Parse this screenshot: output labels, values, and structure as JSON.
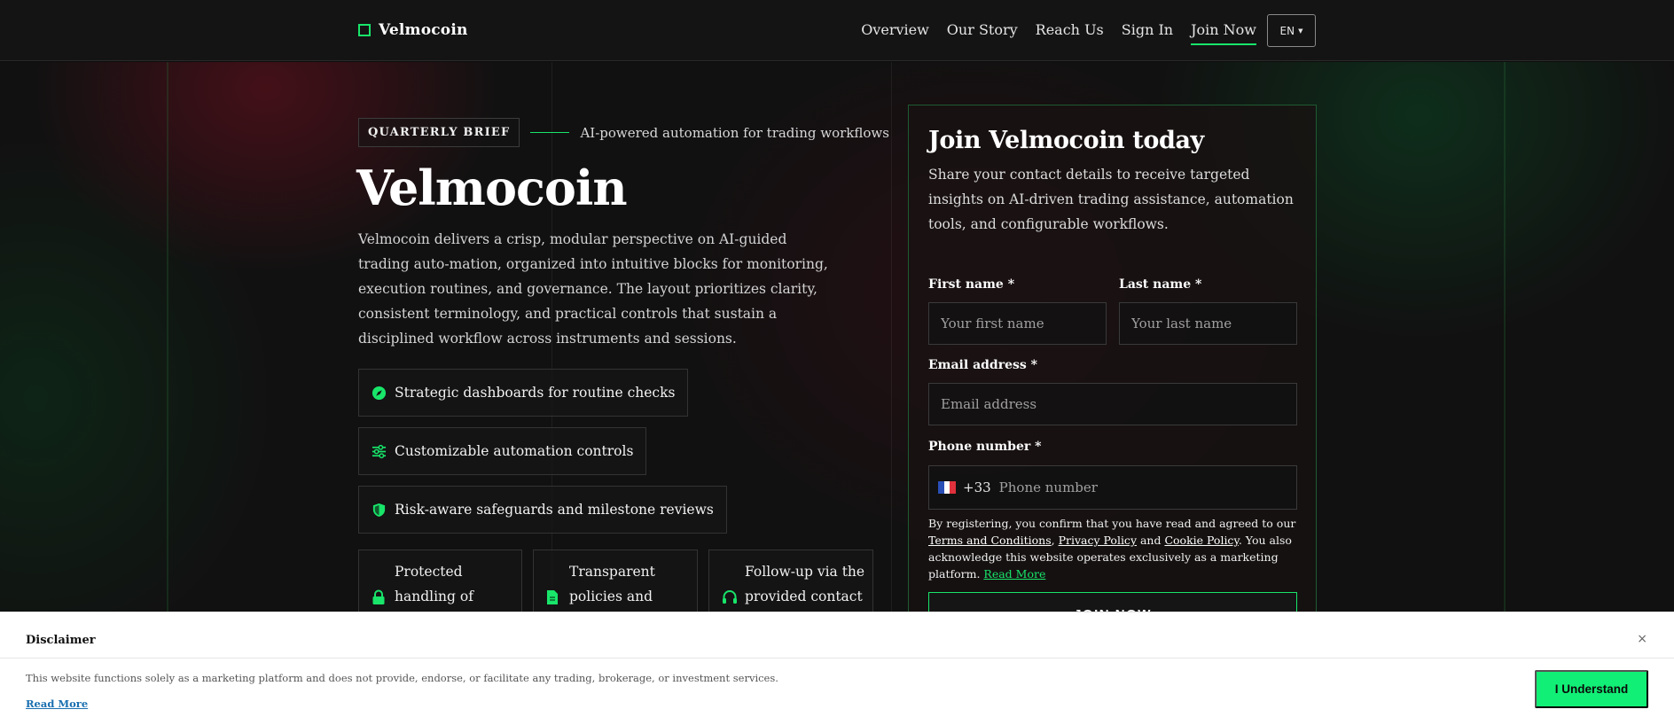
{
  "header": {
    "brand": "Velmocoin",
    "nav": [
      "Overview",
      "Our Story",
      "Reach Us",
      "Sign In",
      "Join Now"
    ],
    "active_nav": "Join Now",
    "language": "EN"
  },
  "hero": {
    "kicker_badge": "QUARTERLY BRIEF",
    "kicker_text": "AI-powered automation for trading workflows",
    "title": "Velmocoin",
    "description": "Velmocoin delivers a crisp, modular perspective on AI-guided trading auto-mation, organized into intuitive blocks for monitoring, execution routines, and governance. The layout prioritizes clarity, consistent terminology, and practical controls that sustain a disciplined workflow across instruments and sessions.",
    "features": [
      {
        "label": "Strategic dashboards for routine checks",
        "icon": "compass-icon"
      },
      {
        "label": "Customizable automation controls",
        "icon": "sliders-icon"
      },
      {
        "label": "Risk-aware safeguards and milestone reviews",
        "icon": "shield-icon"
      }
    ],
    "cards": [
      {
        "label": "Protected handling of",
        "icon": "lock-icon"
      },
      {
        "label": "Transparent policies and",
        "icon": "document-icon"
      },
      {
        "label": "Follow-up via the provided contact",
        "icon": "headset-icon"
      }
    ]
  },
  "form": {
    "title": "Join Velmocoin today",
    "subtitle": "Share your contact details to receive targeted insights on AI-driven trading assistance, automation tools, and configurable workflows.",
    "first_name_label": "First name *",
    "first_name_placeholder": "Your first name",
    "last_name_label": "Last name *",
    "last_name_placeholder": "Your last name",
    "email_label": "Email address *",
    "email_placeholder": "Email address",
    "phone_label": "Phone number *",
    "phone_dial_code": "+33",
    "phone_placeholder": "Phone number",
    "consent": {
      "prefix": "By registering, you confirm that you have read and agreed to our ",
      "terms": "Terms and Conditions",
      "comma": ", ",
      "privacy": "Privacy Policy",
      "and": " and ",
      "cookie": "Cookie Policy",
      "suffix": ". You also acknowledge this website operates exclusively as a marketing platform. ",
      "read_more": "Read More"
    },
    "submit_label": "JOIN NOW",
    "accent_color": "#18e56a"
  },
  "disclaimer": {
    "title": "Disclaimer",
    "close": "×",
    "text": "This website functions solely as a marketing platform and does not provide, endorse, or facilitate any trading, brokerage, or investment services.",
    "read_more": "Read More",
    "button": "I Understand"
  }
}
